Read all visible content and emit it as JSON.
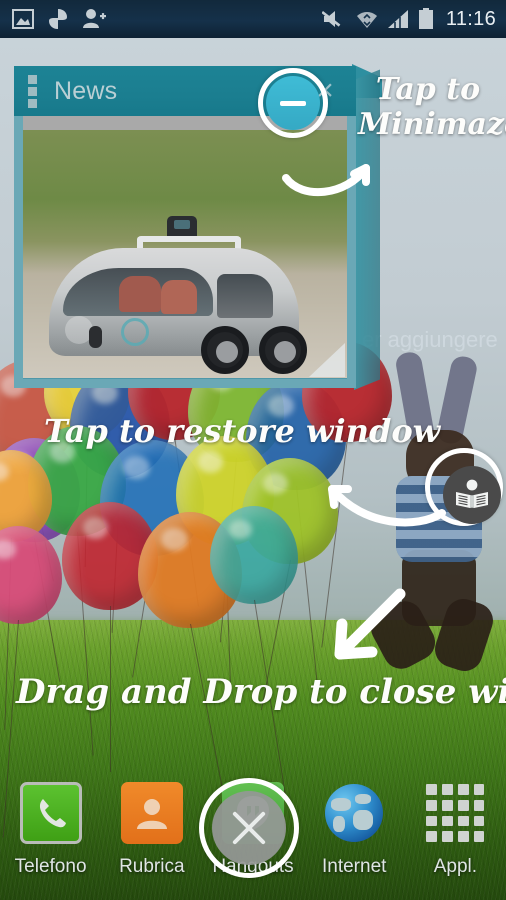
{
  "status_bar": {
    "time": "11:16",
    "left_icons": [
      "screenshot-icon",
      "app-notification-icon",
      "add-contact-icon"
    ],
    "right_icons": [
      "mute-icon",
      "wifi-icon",
      "signal-icon",
      "battery-icon"
    ]
  },
  "floating_window": {
    "title": "News",
    "menu_icon": "drag-handle-icon",
    "minimize_label": "–",
    "close_label": "×",
    "content_image": "self-driving-car-photo"
  },
  "background_text": {
    "partial_hint": "er aggiungere"
  },
  "annotations": {
    "minimize": "Tap to Minimaze",
    "restore": "Tap to restore window",
    "close": "Drag and Drop to close window"
  },
  "floating_badges": {
    "restore_icon": "book-reader-icon",
    "close_icon": "close-x-icon"
  },
  "dock": {
    "items": [
      {
        "label": "Telefono",
        "icon": "phone-icon"
      },
      {
        "label": "Rubrica",
        "icon": "contacts-icon"
      },
      {
        "label": "Hangouts",
        "icon": "hangouts-icon"
      },
      {
        "label": "Internet",
        "icon": "globe-icon"
      },
      {
        "label": "Appl.",
        "icon": "apps-grid-icon"
      }
    ]
  },
  "colors": {
    "titlebar": "#1b7e90",
    "window_frame": "#6aa8b6",
    "minimize_accent": "#3fbcd6",
    "statusbar": "#15314a",
    "annotation_text": "#fdfdfb"
  }
}
